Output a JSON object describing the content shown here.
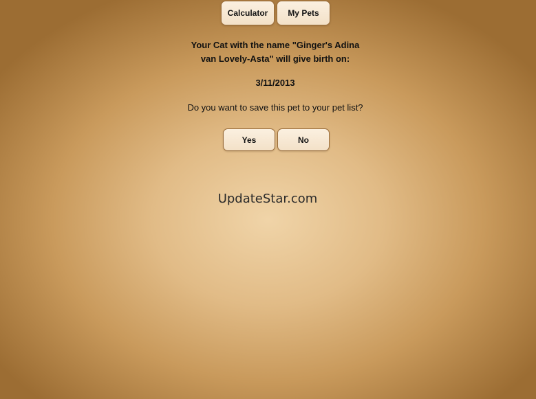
{
  "nav": {
    "calculator_label": "Calculator",
    "my_pets_label": "My Pets"
  },
  "result": {
    "line1": "Your Cat with the name \"Ginger's Adina",
    "line2": "van Lovely-Asta\" will give birth on:",
    "birth_date": "3/11/2013"
  },
  "prompt": {
    "question": "Do you want to save this pet to your pet list?",
    "yes_label": "Yes",
    "no_label": "No"
  },
  "watermark": "UpdateStar.com",
  "colors": {
    "background_center": "#f0d4a8",
    "background_edge": "#9c6d33",
    "button_fill": "#f6e7d1",
    "button_border": "#9a6d3b"
  }
}
